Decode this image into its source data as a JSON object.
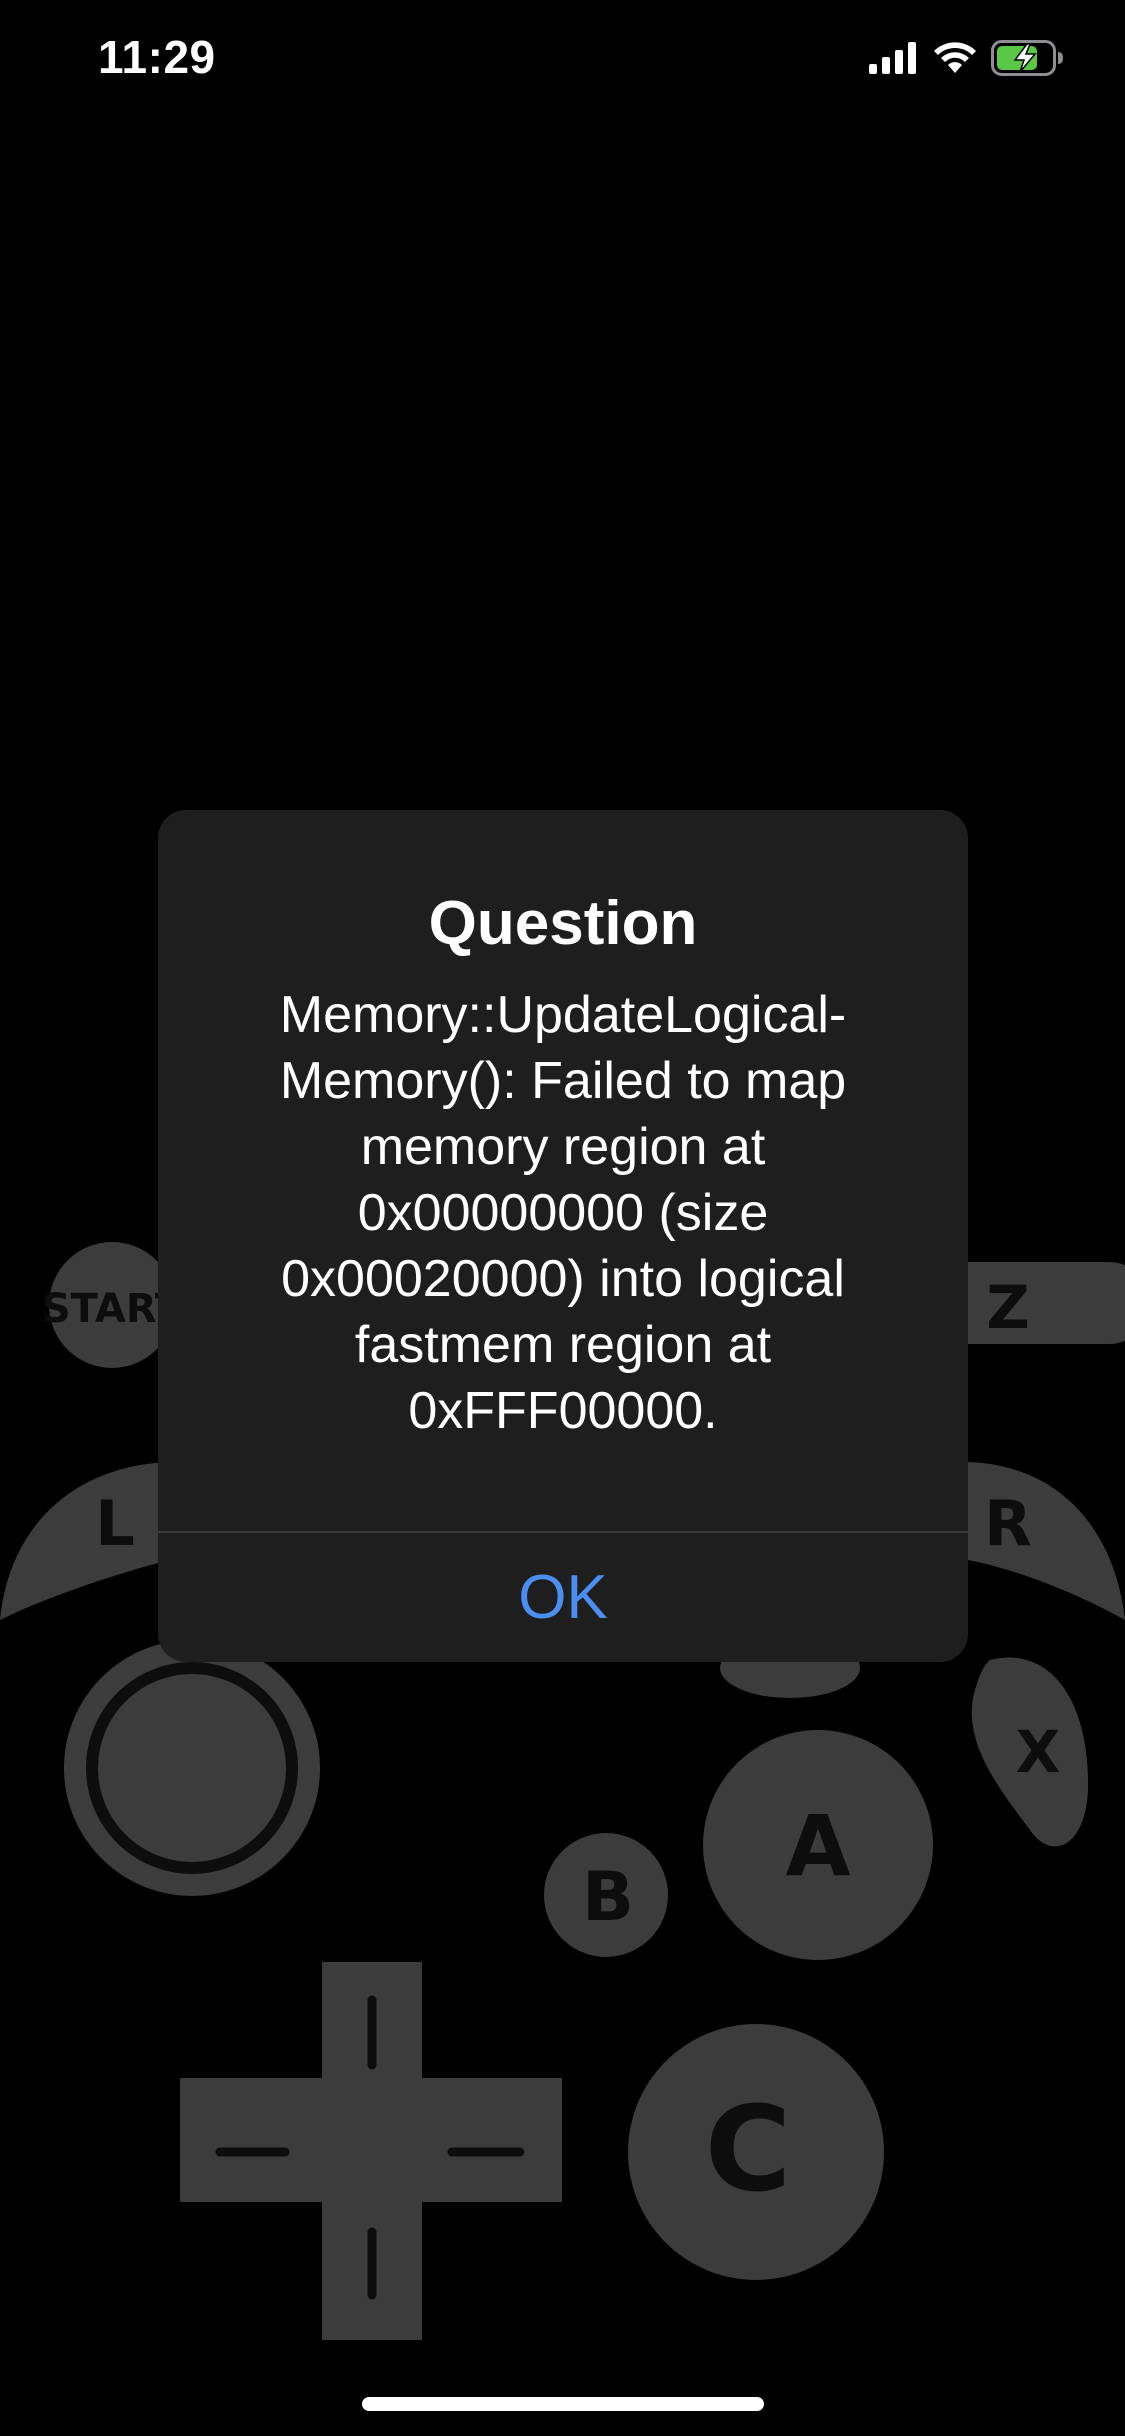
{
  "status_bar": {
    "time": "11:29",
    "icons": [
      "cellular-signal-icon",
      "wifi-icon",
      "battery-charging-icon"
    ]
  },
  "controller": {
    "start_label": "START",
    "z_label": "Z",
    "l_label": "L",
    "r_label": "R",
    "x_label": "X",
    "a_label": "A",
    "b_label": "B",
    "c_label": "C"
  },
  "dialog": {
    "title": "Question",
    "message": "Memory::UpdateLogical-\nMemory(): Failed to map\nmemory region at\n0x00000000 (size\n0x00020000) into logical\nfastmem region at\n0xFFF00000.",
    "ok_label": "OK"
  },
  "colors": {
    "background": "#000000",
    "dialog_bg": "#1e1e1e",
    "controller_gray": "#3c3c3c",
    "accent": "#4a8ff0",
    "battery_green": "#5ac846"
  }
}
